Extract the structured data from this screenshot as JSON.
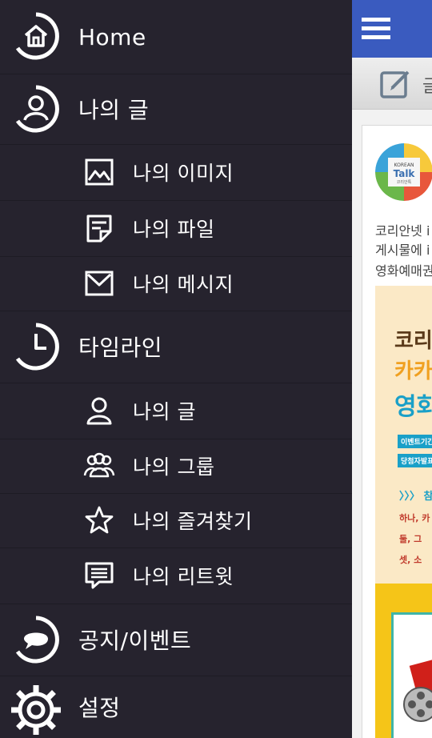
{
  "drawer": {
    "items": [
      {
        "label": "Home",
        "icon": "home-icon"
      },
      {
        "label": "나의 글",
        "icon": "user-icon"
      },
      {
        "label": "나의 이미지",
        "icon": "image-icon"
      },
      {
        "label": "나의 파일",
        "icon": "file-icon"
      },
      {
        "label": "나의 메시지",
        "icon": "mail-icon"
      },
      {
        "label": "타임라인",
        "icon": "clock-icon"
      },
      {
        "label": "나의 글",
        "icon": "user-icon"
      },
      {
        "label": "나의 그룹",
        "icon": "group-icon"
      },
      {
        "label": "나의 즐겨찾기",
        "icon": "star-icon"
      },
      {
        "label": "나의 리트윗",
        "icon": "retweet-icon"
      },
      {
        "label": "공지/이벤트",
        "icon": "chat-icon"
      },
      {
        "label": "설정",
        "icon": "gear-icon"
      }
    ]
  },
  "app": {
    "toolbar_char": "글",
    "logo": {
      "line1": "KOREAN",
      "line2": "Talk",
      "line3": "코리안톡"
    },
    "post_lines": [
      "코리안넷 i",
      "게시물에 i",
      "영화예매권"
    ],
    "banner": {
      "line1": "코리",
      "line2": "카카",
      "line3": "영화",
      "tag1": "이벤트기간",
      "tag2": "당첨자발표",
      "arrow": "〉〉〉 참",
      "item1": "하나, 카",
      "item2": "둘,  그",
      "item3": "셋,  소"
    }
  },
  "colors": {
    "drawer_bg": "#26232e",
    "appbar": "#3a5bbf",
    "text": "#ffffff"
  }
}
